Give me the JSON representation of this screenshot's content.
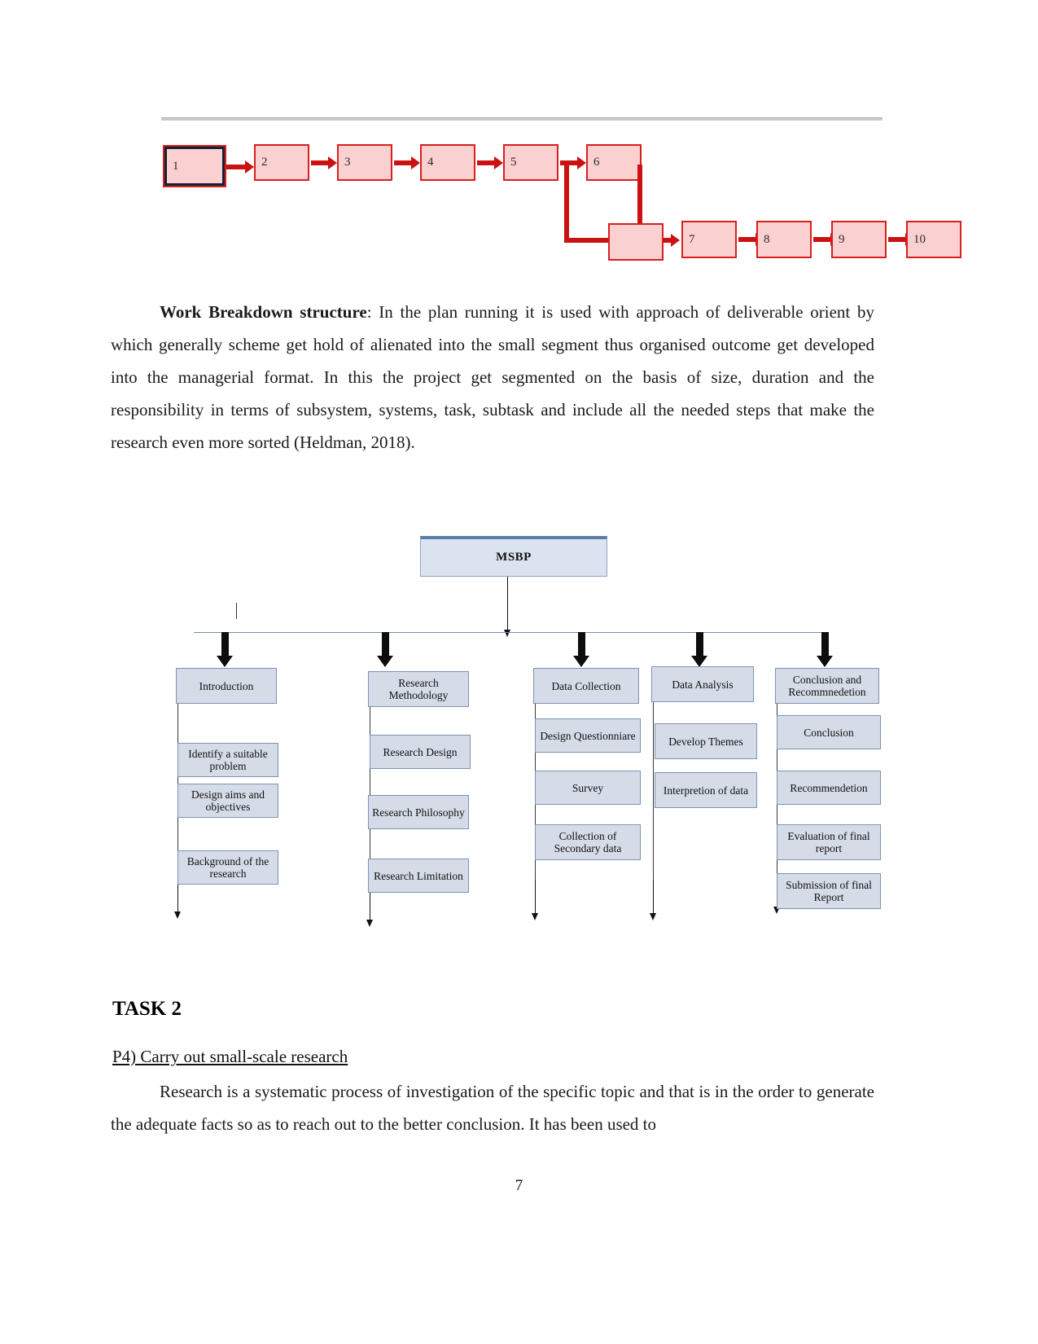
{
  "document": {
    "page_number": "7"
  },
  "network_diagram": {
    "nodes": [
      {
        "id": "1",
        "label": "1"
      },
      {
        "id": "2",
        "label": "2"
      },
      {
        "id": "3",
        "label": "3"
      },
      {
        "id": "4",
        "label": "4"
      },
      {
        "id": "5",
        "label": "5"
      },
      {
        "id": "6",
        "label": "6"
      },
      {
        "id": "7",
        "label": "7"
      },
      {
        "id": "8",
        "label": "8"
      },
      {
        "id": "9",
        "label": "9"
      },
      {
        "id": "10",
        "label": "10"
      }
    ],
    "node_fill": "#fbd0d0",
    "node_border": "#d81f1f",
    "arrow_color": "#cc1111"
  },
  "paragraph1": {
    "lead_bold": "Work Breakdown structure",
    "body": ": In the plan running it is used with approach of deliverable orient by which generally scheme get hold of alienated into the small segment thus organised outcome get developed into the managerial format. In this the project get segmented on the basis of size, duration and the responsibility in terms of subsystem, systems, task, subtask and include all the needed steps that make the research even more sorted (Heldman, 2018)."
  },
  "wbs": {
    "root": "MSBP",
    "box_fill": "#d5dce8",
    "box_border": "#7b93b5",
    "columns": [
      {
        "header": "Introduction",
        "items": [
          "Identify a suitable problem",
          "Design aims and objectives",
          "Background of the research"
        ]
      },
      {
        "header": "Research Methodology",
        "items": [
          "Research Design",
          "Research Philosophy",
          "Research Limitation"
        ]
      },
      {
        "header": "Data Collection",
        "items": [
          "Design Questionniare",
          "Survey",
          "Collection of Secondary data"
        ]
      },
      {
        "header": "Data Analysis",
        "items": [
          "Develop Themes",
          "Interpretion of data"
        ]
      },
      {
        "header": "Conclusion and Recommnedetion",
        "items": [
          "Conclusion",
          "Recommendetion",
          "Evaluation of final report",
          "Submission of final Report"
        ]
      }
    ]
  },
  "task_heading": "TASK 2",
  "subheading": "P4) Carry out small-scale research ",
  "paragraph2": {
    "body": "Research is a systematic process of investigation of the specific topic and that is in the order to generate the adequate facts so as to reach out to the better conclusion. It has been used to"
  }
}
